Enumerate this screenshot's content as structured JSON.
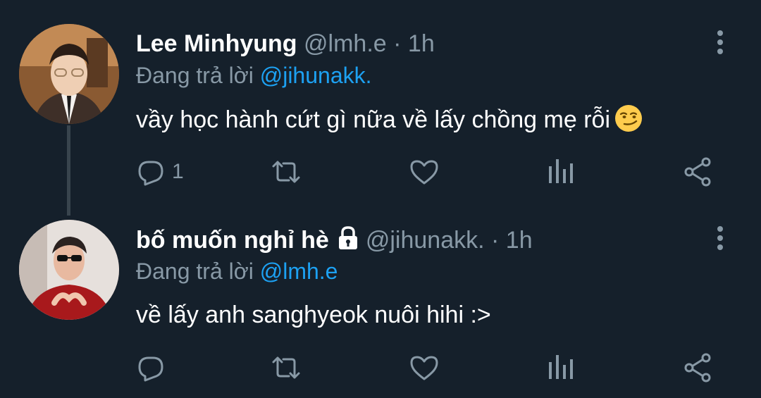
{
  "tweets": [
    {
      "name": "Lee Minhyung",
      "handle": "@lmh.e",
      "separator": "·",
      "time": "1h",
      "reply_prefix": "Đang trả lời",
      "reply_to": "@jihunakk.",
      "text": "vầy học hành cứt gì nữa về lấy chồng mẹ rỗi",
      "emoji": "smirking-face-emoji",
      "reply_count": "1",
      "protected": false
    },
    {
      "name": "bố muốn nghỉ hè",
      "handle": "@jihunakk.",
      "separator": "·",
      "time": "1h",
      "reply_prefix": "Đang trả lời",
      "reply_to": "@lmh.e",
      "text": "về lấy anh sanghyeok nuôi hihi :>",
      "reply_count": "",
      "protected": true
    }
  ],
  "icons": [
    "reply-icon",
    "retweet-icon",
    "like-icon",
    "stats-icon",
    "share-icon",
    "more-icon",
    "lock-icon"
  ],
  "colors": {
    "background": "#15202b",
    "text": "#ffffff",
    "muted": "#8899a6",
    "link": "#1da1f2",
    "thread_line": "#38444d"
  }
}
